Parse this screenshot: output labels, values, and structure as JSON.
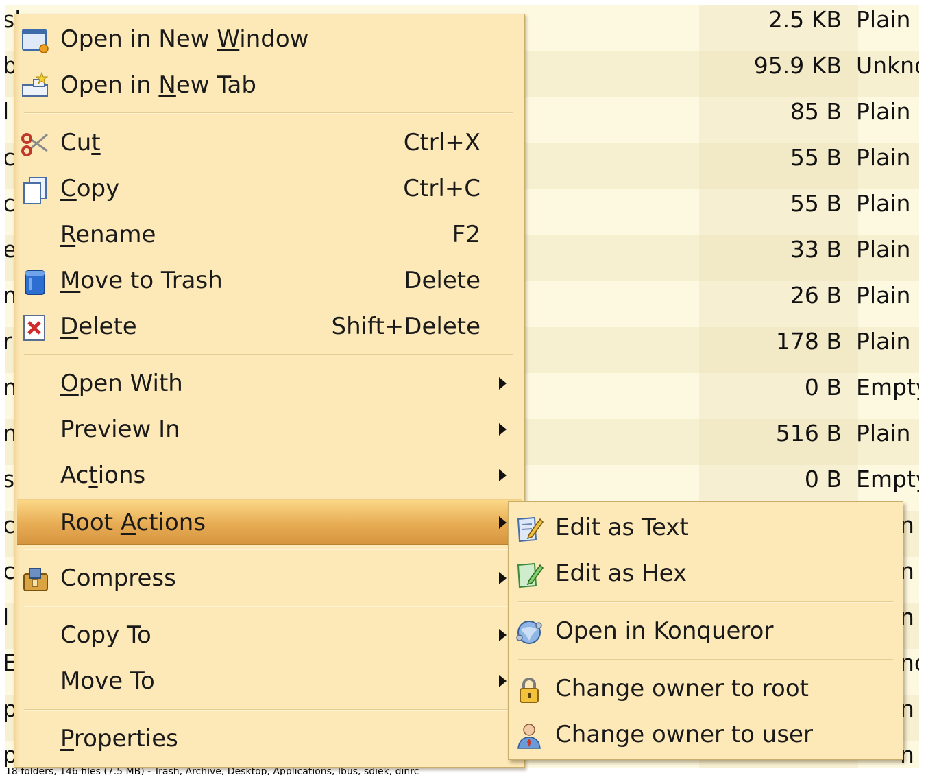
{
  "file_list": {
    "rows": [
      {
        "name": "shre",
        "size": "2.5 KB",
        "type": "Plain"
      },
      {
        "name": "b",
        "size": "95.9 KB",
        "type": "Unkno"
      },
      {
        "name": "l",
        "size": "85 B",
        "type": "Plain"
      },
      {
        "name": "c",
        "size": "55 B",
        "type": "Plain"
      },
      {
        "name": "c",
        "size": "55 B",
        "type": "Plain"
      },
      {
        "name": "e",
        "size": "33 B",
        "type": "Plain"
      },
      {
        "name": "n",
        "size": "26 B",
        "type": "Plain"
      },
      {
        "name": "r",
        "size": "178 B",
        "type": "Plain"
      },
      {
        "name": "n",
        "size": "0 B",
        "type": "Empty"
      },
      {
        "name": "n",
        "size": "516 B",
        "type": "Plain"
      },
      {
        "name": "s",
        "size": "0 B",
        "type": "Empty"
      },
      {
        "name": "c",
        "size": "",
        "type": "n"
      },
      {
        "name": "c",
        "size": "",
        "type": "n"
      },
      {
        "name": "l",
        "size": "",
        "type": "n"
      },
      {
        "name": "E",
        "size": "",
        "type": "nc"
      },
      {
        "name": "p",
        "size": "",
        "type": "n"
      },
      {
        "name": "p",
        "size": "",
        "type": "n"
      }
    ]
  },
  "context_menu": {
    "open_new_window": {
      "pre": "Open in New ",
      "u": "W",
      "post": "indow"
    },
    "open_new_tab": {
      "pre": "Open in ",
      "u": "N",
      "post": "ew Tab"
    },
    "cut": {
      "pre": "Cu",
      "u": "t",
      "post": "",
      "shortcut": "Ctrl+X"
    },
    "copy": {
      "pre": "",
      "u": "C",
      "post": "opy",
      "shortcut": "Ctrl+C"
    },
    "rename": {
      "pre": "",
      "u": "R",
      "post": "ename",
      "shortcut": "F2"
    },
    "move_to_trash": {
      "pre": "",
      "u": "M",
      "post": "ove to Trash",
      "shortcut": "Delete"
    },
    "delete": {
      "pre": "",
      "u": "D",
      "post": "elete",
      "shortcut": "Shift+Delete"
    },
    "open_with": {
      "pre": "",
      "u": "O",
      "post": "pen With"
    },
    "preview_in": {
      "label": "Preview In"
    },
    "actions": {
      "pre": "Ac",
      "u": "t",
      "post": "ions"
    },
    "root_actions": {
      "pre": "Root ",
      "u": "A",
      "post": "ctions"
    },
    "compress": {
      "label": "Compress"
    },
    "copy_to": {
      "label": "Copy To"
    },
    "move_to": {
      "label": "Move To"
    },
    "properties": {
      "pre": "",
      "u": "P",
      "post": "roperties"
    }
  },
  "submenu": {
    "edit_as_text": "Edit as Text",
    "edit_as_hex": "Edit as Hex",
    "open_in_konqueror": "Open in Konqueror",
    "change_owner_root": "Change owner to root",
    "change_owner_user": "Change owner to user"
  },
  "status_bar": "18 folders, 146 files (7.5 MB) - Trash, Archive, Desktop, Applications, Ibus, sdiek, dinrc"
}
